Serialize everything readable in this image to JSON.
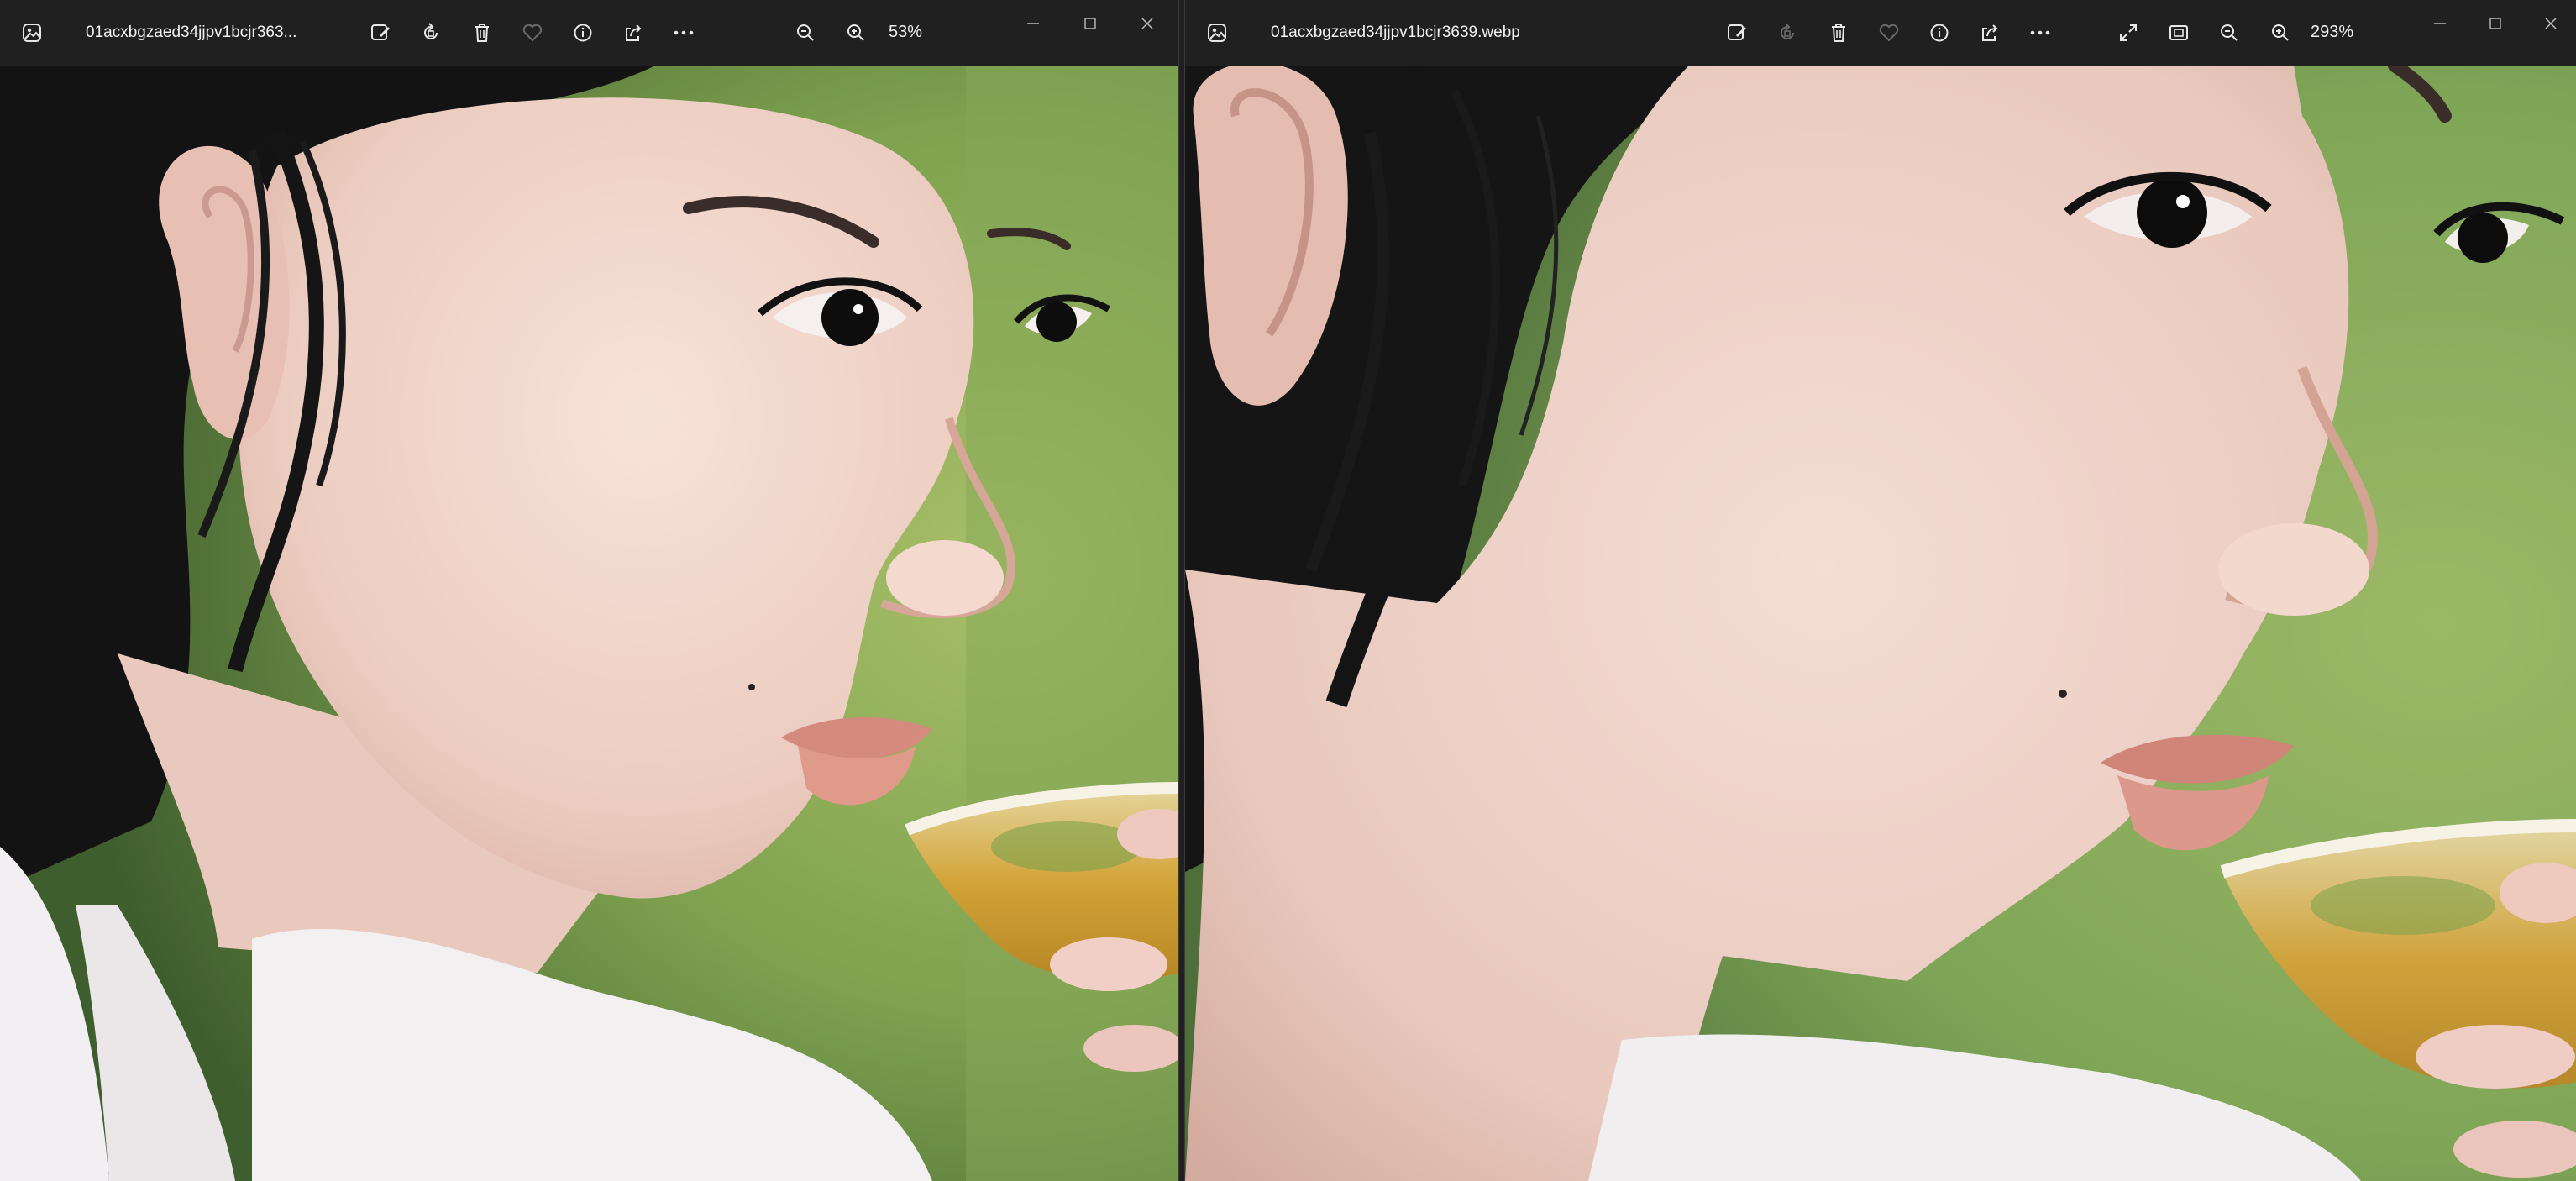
{
  "left_window": {
    "file_name": "01acxbgzaed34jjpv1bcjr363...",
    "zoom": "53%",
    "toolbar_icons": [
      "edit-image-icon",
      "rotate-icon",
      "delete-icon",
      "favorite-icon",
      "info-icon",
      "share-icon",
      "more-icon",
      "zoom-out-icon",
      "zoom-in-icon"
    ]
  },
  "right_window": {
    "file_name": "01acxbgzaed34jjpv1bcjr3639.webp",
    "zoom": "293%",
    "toolbar_icons": [
      "edit-image-icon",
      "rotate-icon",
      "delete-icon",
      "favorite-icon",
      "info-icon",
      "share-icon",
      "more-icon",
      "fit-to-window-icon",
      "actual-size-icon",
      "zoom-out-icon",
      "zoom-in-icon"
    ]
  },
  "colors": {
    "titlebar": "#202020",
    "background_green": "#6e9a4a",
    "skin": "#f0d6cc",
    "hair": "#141414",
    "lips": "#d98f80",
    "tea": "#d9a93a"
  }
}
